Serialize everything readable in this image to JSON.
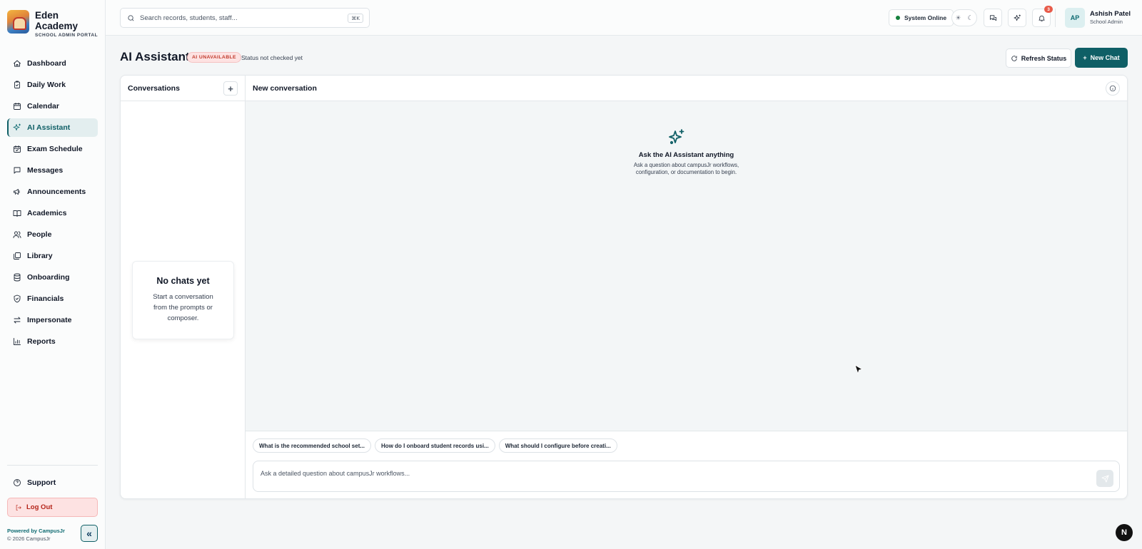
{
  "brand": {
    "name": "Eden Academy",
    "subtitle": "SCHOOL ADMIN PORTAL",
    "logo_icon": "school-crest-logo"
  },
  "sidebar": {
    "items": [
      {
        "label": "Dashboard",
        "icon": "dashboard-icon"
      },
      {
        "label": "Daily Work",
        "icon": "clipboard-icon"
      },
      {
        "label": "Calendar",
        "icon": "calendar-icon"
      },
      {
        "label": "AI Assistant",
        "icon": "sparkle-icon",
        "active": true
      },
      {
        "label": "Exam Schedule",
        "icon": "calendar-check-icon"
      },
      {
        "label": "Messages",
        "icon": "message-icon"
      },
      {
        "label": "Announcements",
        "icon": "megaphone-icon"
      },
      {
        "label": "Academics",
        "icon": "book-icon"
      },
      {
        "label": "People",
        "icon": "users-icon"
      },
      {
        "label": "Library",
        "icon": "library-icon"
      },
      {
        "label": "Onboarding",
        "icon": "database-icon"
      },
      {
        "label": "Financials",
        "icon": "shield-icon"
      },
      {
        "label": "Impersonate",
        "icon": "swap-icon"
      },
      {
        "label": "Reports",
        "icon": "bar-chart-icon"
      }
    ],
    "support_label": "Support",
    "logout_label": "Log Out",
    "powered_by": "Powered by CampusJr",
    "copyright": "© 2026 CampusJr",
    "collapse_glyph": "«"
  },
  "topbar": {
    "search_placeholder": "Search records, students, staff...",
    "search_shortcut": "⌘K",
    "system_status": "System Online",
    "notification_count": "3",
    "user": {
      "initials": "AP",
      "name": "Ashish Patel",
      "role": "School Admin"
    }
  },
  "page": {
    "title": "AI Assistant",
    "ai_status_badge": "AI UNAVAILABLE",
    "status_note": "Status not checked yet",
    "refresh_label": "Refresh Status",
    "new_chat_label": "New Chat"
  },
  "conversations": {
    "header": "Conversations",
    "add_glyph": "+",
    "empty_title": "No chats yet",
    "empty_desc": "Start a conversation from the prompts or composer."
  },
  "chat": {
    "header": "New conversation",
    "empty_title": "Ask the AI Assistant anything",
    "empty_desc": "Ask a question about campusJr workflows, configuration, or documentation to begin.",
    "prompts": [
      "What is the recommended school set...",
      "How do I onboard student records usi...",
      "What should I configure before creati..."
    ],
    "composer_placeholder": "Ask a detailed question about campusJr workflows..."
  },
  "floating": {
    "n_button": "N"
  },
  "colors": {
    "accent": "#0f5f66",
    "danger": "#c0392b",
    "online": "#15803d"
  }
}
